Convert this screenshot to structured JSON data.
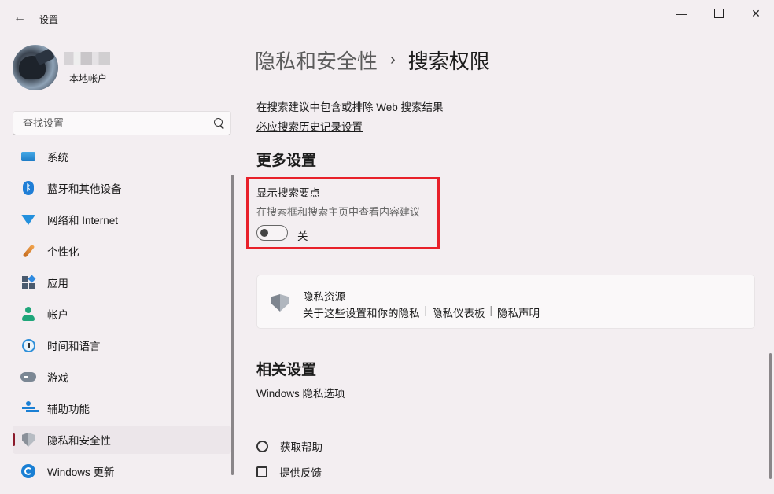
{
  "window": {
    "title": "设置",
    "back_glyph": "←",
    "minimize_glyph": "—",
    "close_glyph": "✕"
  },
  "profile": {
    "account_type": "本地帐户"
  },
  "search": {
    "placeholder": "查找设置"
  },
  "sidebar": {
    "items": [
      {
        "label": "系统",
        "icon": "system-icon"
      },
      {
        "label": "蓝牙和其他设备",
        "icon": "bluetooth-icon"
      },
      {
        "label": "网络和 Internet",
        "icon": "wifi-icon"
      },
      {
        "label": "个性化",
        "icon": "brush-icon"
      },
      {
        "label": "应用",
        "icon": "apps-icon"
      },
      {
        "label": "帐户",
        "icon": "account-icon"
      },
      {
        "label": "时间和语言",
        "icon": "clock-icon"
      },
      {
        "label": "游戏",
        "icon": "gamepad-icon"
      },
      {
        "label": "辅助功能",
        "icon": "accessibility-icon"
      },
      {
        "label": "隐私和安全性",
        "icon": "shield-icon",
        "active": true
      },
      {
        "label": "Windows 更新",
        "icon": "update-icon"
      }
    ]
  },
  "main": {
    "breadcrumb": {
      "parent": "隐私和安全性",
      "separator": "›",
      "current": "搜索权限"
    },
    "exclude_web_text": "在搜索建议中包含或排除 Web 搜索结果",
    "bing_history_link": "必应搜索历史记录设置",
    "more_settings": {
      "heading": "更多设置",
      "search_highlights": {
        "title": "显示搜索要点",
        "description": "在搜索框和搜索主页中查看内容建议",
        "toggle_state": "关",
        "toggle_on": false
      }
    },
    "privacy_resources": {
      "title": "隐私资源",
      "links": [
        "关于这些设置和你的隐私",
        "隐私仪表板",
        "隐私声明"
      ],
      "divider": "|"
    },
    "related": {
      "heading": "相关设置",
      "windows_privacy_link": "Windows 隐私选项"
    },
    "help": {
      "get_help": "获取帮助",
      "give_feedback": "提供反馈"
    }
  },
  "colors": {
    "highlight_border": "#e8202a",
    "active_indicator": "#8b1a2b",
    "background": "#f3eef1"
  }
}
